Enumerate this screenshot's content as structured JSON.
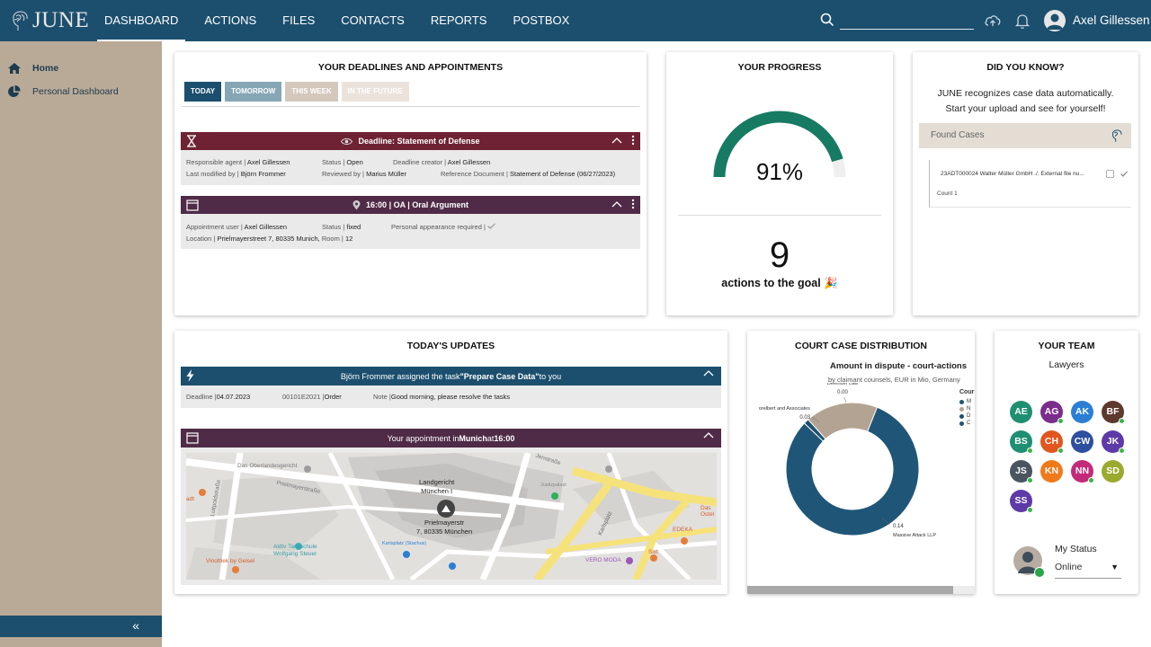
{
  "header": {
    "logo_text": "JUNE",
    "nav": [
      "DASHBOARD",
      "ACTIONS",
      "FILES",
      "CONTACTS",
      "REPORTS",
      "POSTBOX"
    ],
    "user_name": "Axel Gillessen",
    "search_value": ""
  },
  "sidebar": {
    "items": [
      {
        "label": "Home",
        "icon": "home-icon"
      },
      {
        "label": "Personal Dashboard",
        "icon": "pie-chart-icon"
      }
    ],
    "collapse": "«"
  },
  "deadlines": {
    "title": "YOUR DEADLINES AND APPOINTMENTS",
    "tabs": [
      {
        "label": "TODAY",
        "color": "#1c4f6e"
      },
      {
        "label": "TOMORROW",
        "color": "#86a6b6"
      },
      {
        "label": "THIS WEEK",
        "color": "#d4c8bd"
      },
      {
        "label": "IN THE FUTURE",
        "color": "#ebe3db"
      }
    ],
    "deadline": {
      "title": "Deadline: Statement of Defense",
      "agent_label": "Responsible agent |",
      "agent": "Axel Gillessen",
      "status_label": "Status |",
      "status": "Open",
      "creator_label": "Deadline creator |",
      "creator": "Axel Gillessen",
      "modified_label": "Last modified by |",
      "modified": "Björn Frommer",
      "reviewed_label": "Reviewed by |",
      "reviewed": "Marius Müller",
      "refdoc_label": "Reference Document |",
      "refdoc": "Statement of Defense (06/27/2023)"
    },
    "appointment": {
      "title": "16:00 | OA | Oral Argument",
      "user_label": "Appointment user |",
      "user": "Axel Gillessen",
      "status_label": "Status |",
      "status": "fixed",
      "personal_label": "Personal appearance required |",
      "location_label": "Location |",
      "location": "Prielmayerstreet 7, 80335 Munich,",
      "room_label": "Room |",
      "room": "12"
    }
  },
  "progress": {
    "title": "YOUR PROGRESS",
    "percent_text": "91%",
    "percent": 0.91,
    "count": "9",
    "goal_text": "actions to the goal",
    "emoji": "🎉"
  },
  "didyouknow": {
    "title": "DID YOU KNOW?",
    "line1": "JUNE recognizes case data automatically.",
    "line2": "Start your upload and see for yourself!",
    "found_cases": "Found Cases",
    "case_item": "23ADT000024 Walter Müller GmbH ./. External file nu...",
    "count": "Count 1"
  },
  "updates": {
    "title": "TODAY'S UPDATES",
    "task_prefix": "Björn Frommer assigned the task ",
    "task_name": "\"Prepare Case Data\"",
    "task_suffix": " to you",
    "deadline_label": "Deadline |",
    "deadline": "04.07.2023",
    "case_no": "00101E2021 |",
    "case_type": "Order",
    "note_label": "Note |",
    "note": "Good morning, please resolve the tasks",
    "appt_prefix": "Your appointment in ",
    "appt_city": "Munich",
    "appt_mid": " at ",
    "appt_time": "16:00",
    "map": {
      "court": "Landgericht",
      "court2": "München I",
      "addr1": "Prielmayerstr",
      "addr2": "7, 80335 München",
      "labels": [
        "Das Oberlandesgericht",
        "Prielmayerstraße",
        "Justizpalast",
        "Karlsplatz",
        "Aldtv Tanzschule",
        "Wolfgang Steuer",
        "Vinothek by Geisel",
        "Karlsplatz (Stachus)",
        "VERO MODA",
        "EDEKA",
        "Sixt",
        "Jenstraße",
        "Luitpoldstraße",
        "Das Ostel",
        "adt"
      ]
    }
  },
  "court": {
    "title": "COURT CASE DISTRIBUTION",
    "chart_title": "Amount in dispute - court-actions",
    "subtitle": "by claimant counsels, EUR in Mio, Germany",
    "legend_title": "Cour"
  },
  "chart_data": {
    "type": "pie",
    "title": "Amount in dispute - court-actions",
    "subtitle": "by claimant counsels, EUR in Mio, Germany",
    "categories": [
      "Massive Attack LLP",
      "Defender Law",
      "Brelbert and Associates"
    ],
    "values": [
      0.14,
      0.0,
      0.03
    ],
    "value_labels": [
      "0.14",
      "0.00",
      "0.03"
    ],
    "label_texts": [
      "Massive Attack LLP",
      "Defender Law",
      "orelbert and Associates"
    ],
    "colors": [
      "#1f5678",
      "#1c4f6e",
      "#b3a393"
    ],
    "legend_colors": [
      "#1f5678",
      "#b3a393",
      "#1c4f6e",
      "#1f5678"
    ],
    "legend_entries": [
      "M",
      "N",
      "D",
      "C"
    ],
    "legend_position": "right"
  },
  "team": {
    "title": "YOUR TEAM",
    "subtitle": "Lawyers",
    "members": [
      {
        "initials": "AE",
        "color": "#1f8f72",
        "online": false
      },
      {
        "initials": "AG",
        "color": "#7b2d8e",
        "online": true
      },
      {
        "initials": "AK",
        "color": "#2a7fd4",
        "online": false
      },
      {
        "initials": "BF",
        "color": "#5e3a2e",
        "online": true
      },
      {
        "initials": "BS",
        "color": "#1f8f72",
        "online": true
      },
      {
        "initials": "CH",
        "color": "#e0561e",
        "online": true
      },
      {
        "initials": "CW",
        "color": "#2c4f9f",
        "online": false
      },
      {
        "initials": "JK",
        "color": "#5e3aa8",
        "online": true
      },
      {
        "initials": "JS",
        "color": "#4a5560",
        "online": true
      },
      {
        "initials": "KN",
        "color": "#ef7a1a",
        "online": false
      },
      {
        "initials": "NN",
        "color": "#c22a7a",
        "online": true
      },
      {
        "initials": "SD",
        "color": "#9aaa2e",
        "online": false
      },
      {
        "initials": "SS",
        "color": "#5e3aa8",
        "online": true
      }
    ],
    "status_label": "My Status",
    "status_value": "Online"
  }
}
